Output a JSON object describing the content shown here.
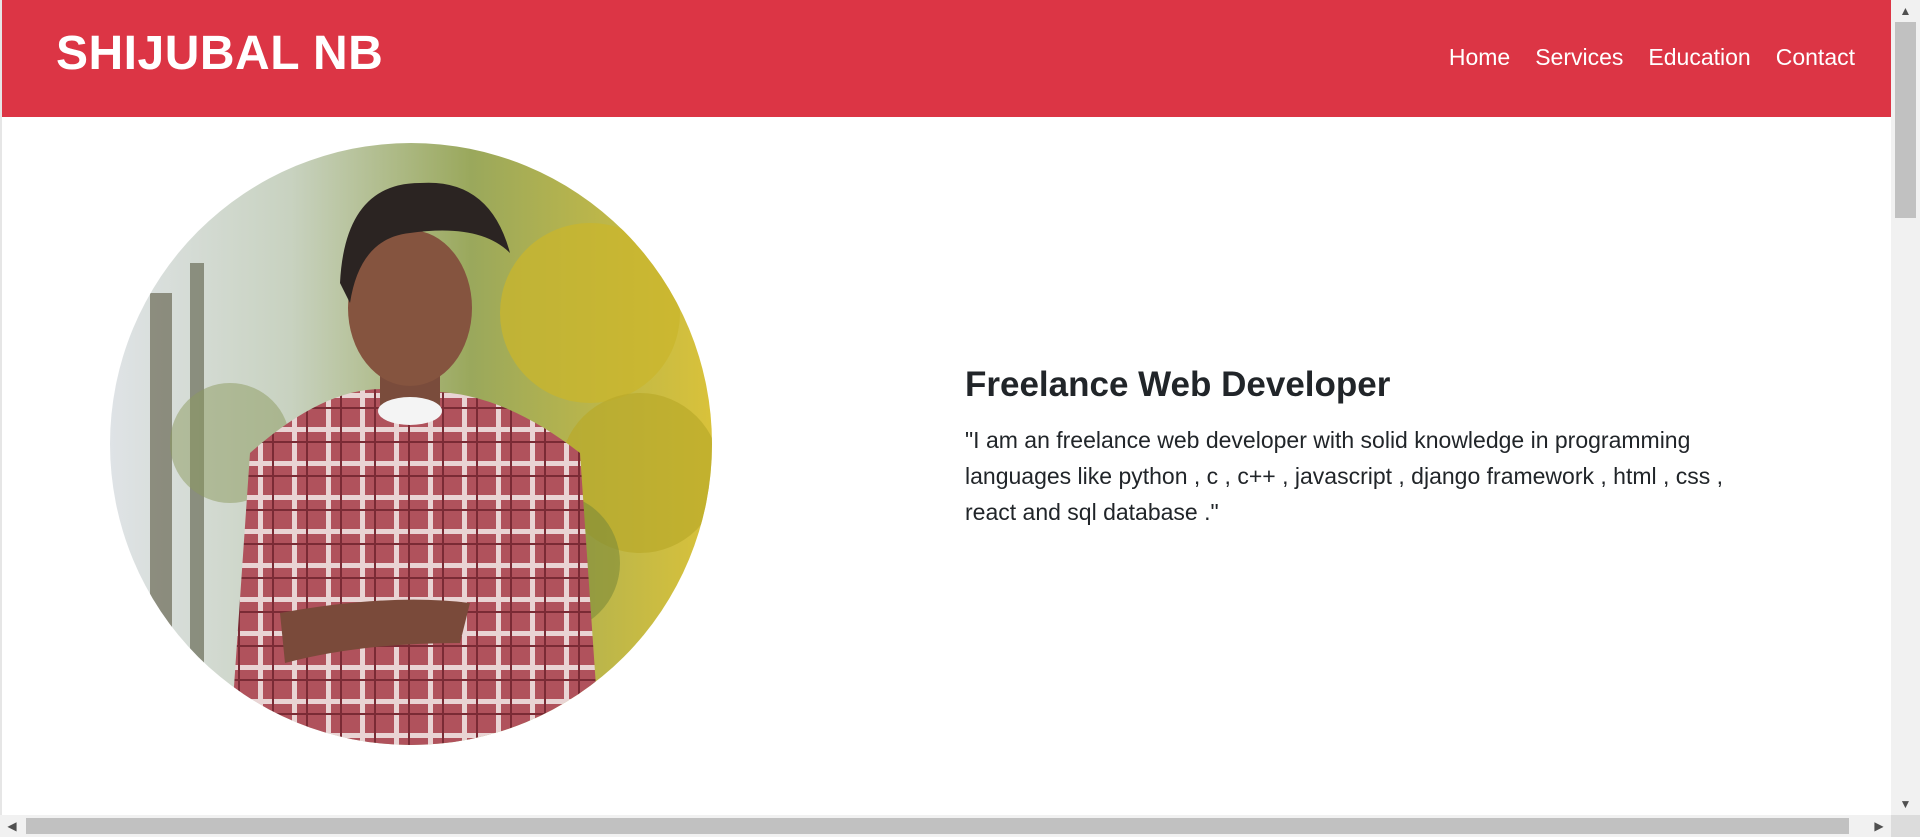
{
  "navbar": {
    "brand": "SHIJUBAL NB",
    "links": [
      {
        "label": "Home"
      },
      {
        "label": "Services"
      },
      {
        "label": "Education"
      },
      {
        "label": "Contact"
      }
    ]
  },
  "hero": {
    "title": "Freelance Web Developer",
    "description": "\"I am an freelance web developer with solid knowledge in programming languages like python , c , c++ , javascript , django framework , html , css , react and sql database .\""
  },
  "colors": {
    "navbar": "#dc3545",
    "text": "#212529",
    "white": "#ffffff"
  },
  "icons": {
    "scroll_up": "▲",
    "scroll_down": "▼",
    "scroll_left": "◀",
    "scroll_right": "▶"
  }
}
